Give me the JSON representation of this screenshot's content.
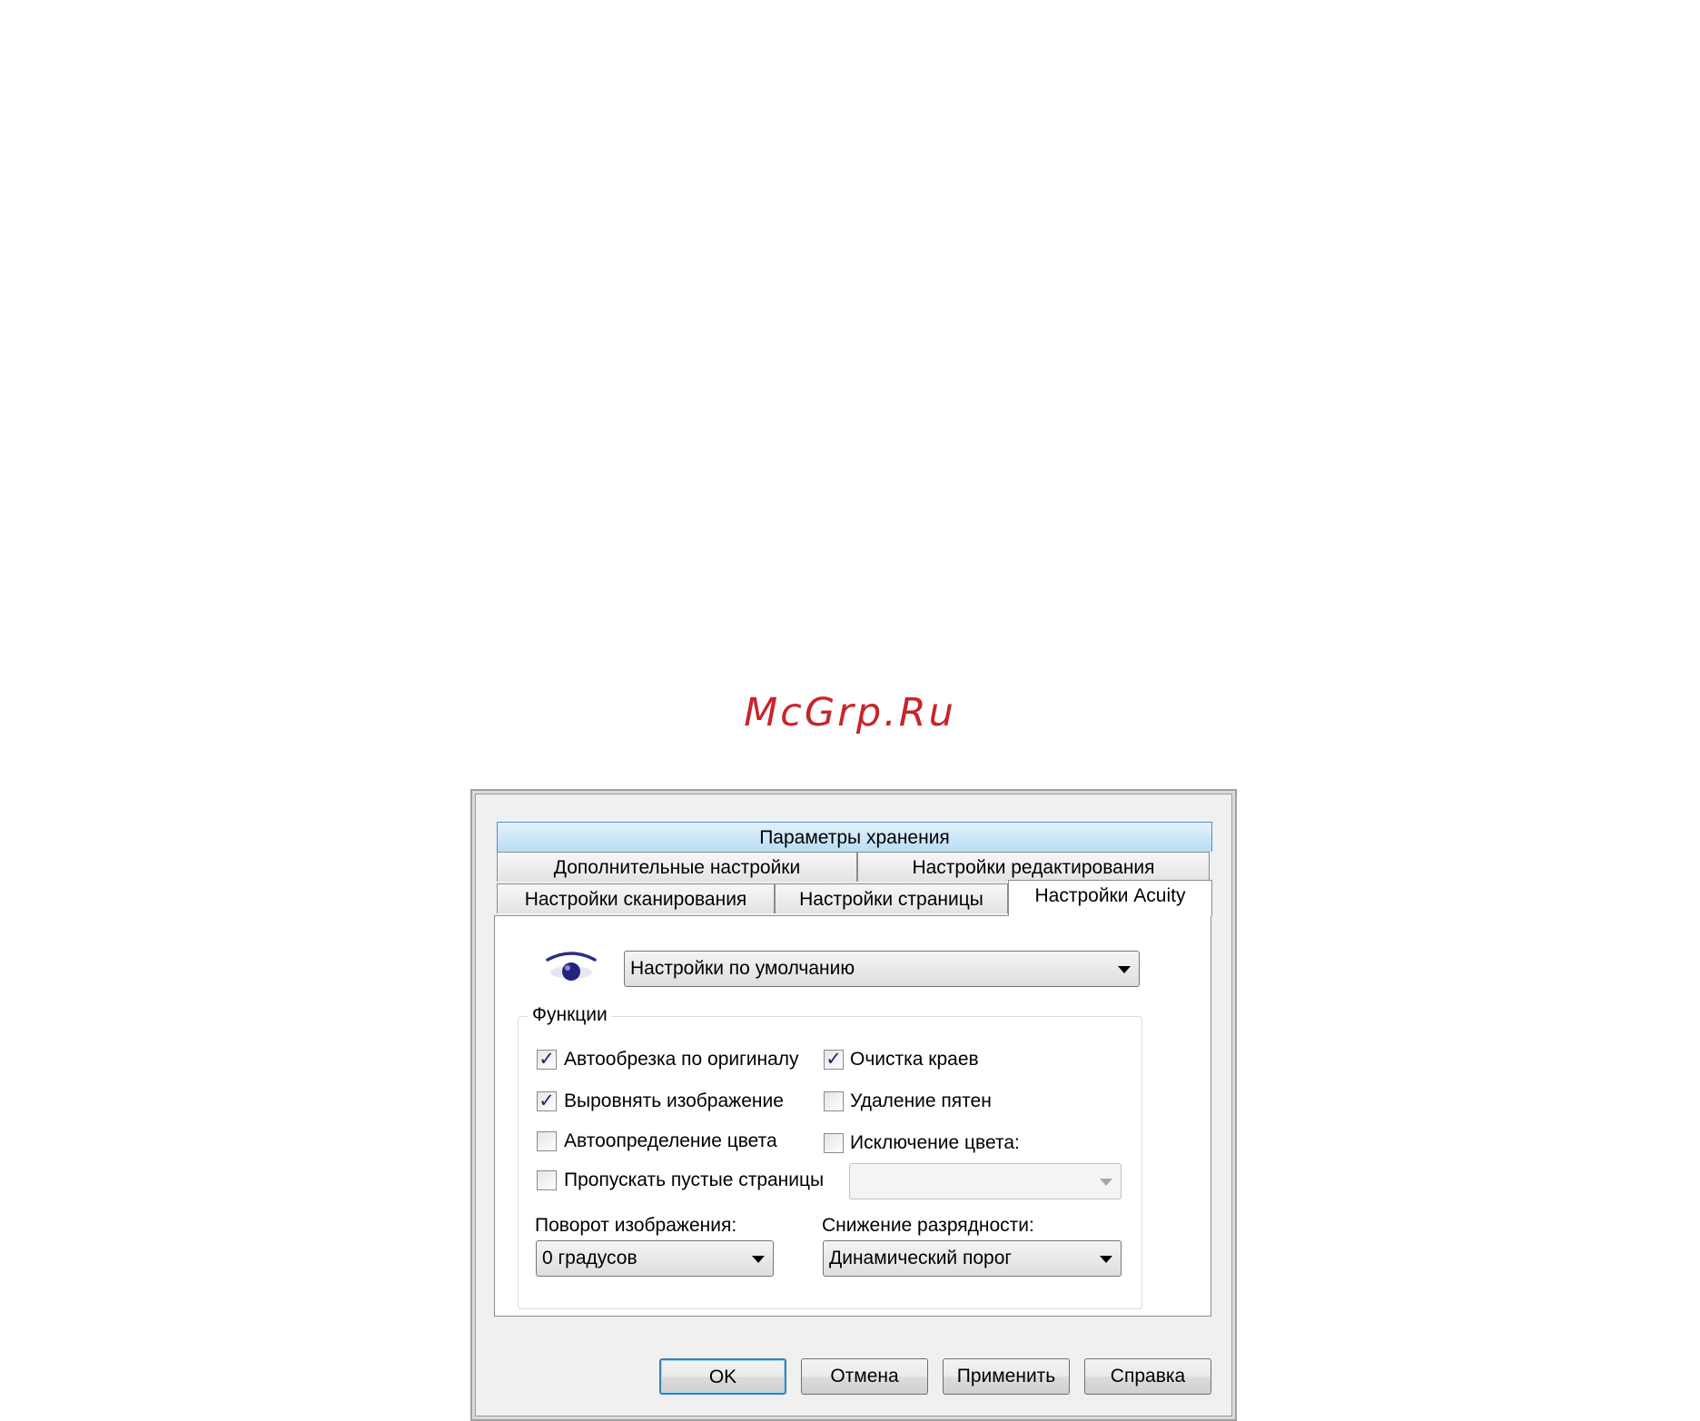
{
  "watermark": "McGrp.Ru",
  "tabs": {
    "row1": [
      "Параметры хранения"
    ],
    "row2": [
      "Дополнительные настройки",
      "Настройки редактирования"
    ],
    "row3": [
      "Настройки сканирования",
      "Настройки страницы",
      "Настройки Acuity"
    ],
    "active": "Настройки Acuity"
  },
  "profile": {
    "icon": "eye-icon",
    "selected": "Настройки по умолчанию"
  },
  "functions": {
    "legend": "Функции",
    "checkboxes": [
      {
        "label": "Автообрезка по оригиналу",
        "checked": true
      },
      {
        "label": "Очистка краев",
        "checked": true
      },
      {
        "label": "Выровнять изображение",
        "checked": true
      },
      {
        "label": "Удаление пятен",
        "checked": false
      },
      {
        "label": "Автоопределение цвета",
        "checked": false
      },
      {
        "label": "Исключение цвета:",
        "checked": false
      },
      {
        "label": "Пропускать пустые страницы",
        "checked": false
      }
    ],
    "color_exclusion_value": "",
    "rotation": {
      "label": "Поворот изображения:",
      "value": "0 градусов"
    },
    "bit_depth": {
      "label": "Снижение разрядности:",
      "value": "Динамический порог"
    }
  },
  "buttons": {
    "ok": "OK",
    "cancel": "Отмена",
    "apply": "Применить",
    "help": "Справка"
  },
  "colors": {
    "highlight_tab": "#b8dcf6",
    "default_button_border": "#3c7fb1",
    "watermark": "#c8242b"
  }
}
